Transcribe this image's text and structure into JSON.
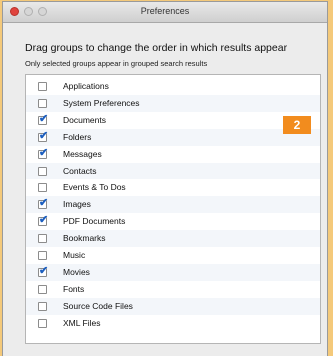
{
  "window": {
    "title": "Preferences"
  },
  "heading": "Drag groups to change the order in which results appear",
  "subheading": "Only selected groups appear in grouped search results",
  "badge": "2",
  "items": [
    {
      "label": "Applications",
      "checked": false
    },
    {
      "label": "System Preferences",
      "checked": false
    },
    {
      "label": "Documents",
      "checked": true
    },
    {
      "label": "Folders",
      "checked": true
    },
    {
      "label": "Messages",
      "checked": true
    },
    {
      "label": "Contacts",
      "checked": false
    },
    {
      "label": "Events & To Dos",
      "checked": false
    },
    {
      "label": "Images",
      "checked": true
    },
    {
      "label": "PDF Documents",
      "checked": true
    },
    {
      "label": "Bookmarks",
      "checked": false
    },
    {
      "label": "Music",
      "checked": false
    },
    {
      "label": "Movies",
      "checked": true
    },
    {
      "label": "Fonts",
      "checked": false
    },
    {
      "label": "Source Code Files",
      "checked": false
    },
    {
      "label": "XML Files",
      "checked": false
    }
  ],
  "colors": {
    "accent": "#f28c1e",
    "check": "#1d5fbf",
    "frame": "#f4c97a"
  }
}
